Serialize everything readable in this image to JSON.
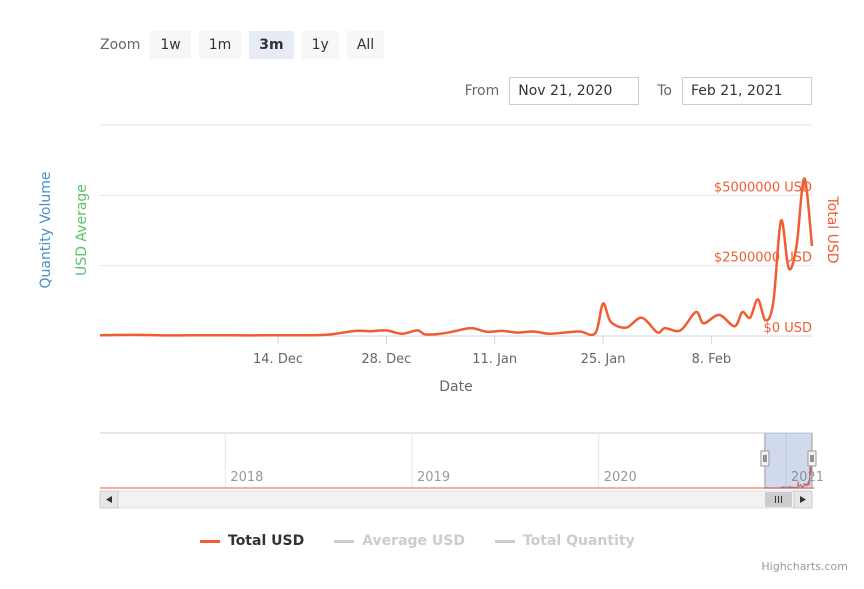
{
  "zoom": {
    "label": "Zoom",
    "buttons": [
      {
        "label": "1w",
        "active": false
      },
      {
        "label": "1m",
        "active": false
      },
      {
        "label": "3m",
        "active": true
      },
      {
        "label": "1y",
        "active": false
      },
      {
        "label": "All",
        "active": false
      }
    ]
  },
  "range": {
    "from_label": "From",
    "from_value": "Nov 21, 2020",
    "to_label": "To",
    "to_value": "Feb 21, 2021"
  },
  "legend": [
    {
      "name": "Total USD",
      "color": "#f15c30",
      "visible": true
    },
    {
      "name": "Average USD",
      "color": "#cccccc",
      "visible": false
    },
    {
      "name": "Total Quantity",
      "color": "#cccccc",
      "visible": false
    }
  ],
  "credit": "Highcharts.com",
  "chart_data": {
    "type": "line",
    "xlabel": "Date",
    "y_axes": [
      {
        "label": "Quantity Volume",
        "color": "#4a90c8",
        "side": "left"
      },
      {
        "label": "USD Average",
        "color": "#5cc26a",
        "side": "left"
      },
      {
        "label": "Total USD",
        "color": "#f15c30",
        "side": "right"
      }
    ],
    "ylim": [
      0,
      7500000
    ],
    "yticks": [
      {
        "value": 0,
        "label": "$0 USD"
      },
      {
        "value": 2500000,
        "label": "$2500000 USD"
      },
      {
        "value": 5000000,
        "label": "$5000000 USD"
      }
    ],
    "xlim": [
      "2020-11-21",
      "2021-02-21"
    ],
    "xticks": [
      {
        "date": "2020-12-14",
        "label": "14. Dec"
      },
      {
        "date": "2020-12-28",
        "label": "28. Dec"
      },
      {
        "date": "2021-01-11",
        "label": "11. Jan"
      },
      {
        "date": "2021-01-25",
        "label": "25. Jan"
      },
      {
        "date": "2021-02-08",
        "label": "8. Feb"
      }
    ],
    "grid": true,
    "series": [
      {
        "name": "Total USD",
        "color": "#f15c30",
        "x": [
          "2020-11-21",
          "2020-11-26",
          "2020-11-30",
          "2020-12-05",
          "2020-12-10",
          "2020-12-15",
          "2020-12-20",
          "2020-12-24",
          "2020-12-26",
          "2020-12-28",
          "2020-12-30",
          "2021-01-01",
          "2021-01-02",
          "2021-01-04",
          "2021-01-06",
          "2021-01-08",
          "2021-01-10",
          "2021-01-12",
          "2021-01-14",
          "2021-01-16",
          "2021-01-18",
          "2021-01-20",
          "2021-01-22",
          "2021-01-24",
          "2021-01-25",
          "2021-01-26",
          "2021-01-28",
          "2021-01-30",
          "2021-02-01",
          "2021-02-02",
          "2021-02-04",
          "2021-02-06",
          "2021-02-07",
          "2021-02-09",
          "2021-02-11",
          "2021-02-12",
          "2021-02-13",
          "2021-02-14",
          "2021-02-15",
          "2021-02-16",
          "2021-02-17",
          "2021-02-18",
          "2021-02-19",
          "2021-02-20",
          "2021-02-21"
        ],
        "values": [
          30000,
          40000,
          20000,
          30000,
          20000,
          30000,
          40000,
          180000,
          170000,
          200000,
          80000,
          200000,
          60000,
          80000,
          180000,
          280000,
          150000,
          180000,
          120000,
          160000,
          80000,
          120000,
          160000,
          100000,
          1150000,
          500000,
          300000,
          650000,
          130000,
          280000,
          200000,
          850000,
          450000,
          750000,
          350000,
          850000,
          650000,
          1300000,
          550000,
          1200000,
          4100000,
          2400000,
          3200000,
          5600000,
          3200000
        ]
      }
    ],
    "navigator": {
      "xticks": [
        {
          "date": "2018-01-01",
          "label": "2018"
        },
        {
          "date": "2019-01-01",
          "label": "2019"
        },
        {
          "date": "2020-01-01",
          "label": "2020"
        },
        {
          "date": "2021-01-01",
          "label": "2021"
        }
      ]
    }
  }
}
